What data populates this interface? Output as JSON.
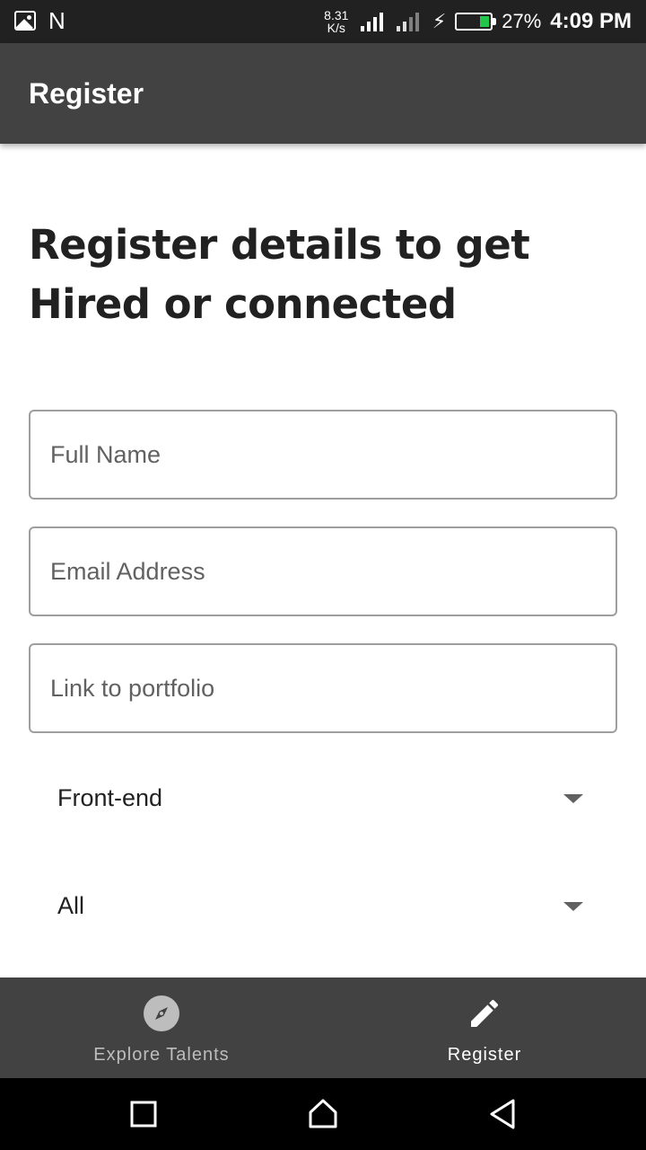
{
  "status_bar": {
    "notification_letter": "N",
    "speed_value": "8.31",
    "speed_unit": "K/s",
    "battery_percent": "27%",
    "time": "4:09 PM",
    "battery_color": "#22c64a",
    "icons": [
      "gallery-icon",
      "signal-icon",
      "charging-icon",
      "battery-icon"
    ]
  },
  "app_bar": {
    "title": "Register",
    "background": "#424242"
  },
  "main": {
    "headline_line1": "Register details to get",
    "headline_line2": "Hired or connected",
    "fields": {
      "full_name_placeholder": "Full Name",
      "email_placeholder": "Email Address",
      "portfolio_placeholder": "Link to portfolio"
    },
    "dropdowns": {
      "role_value": "Front-end",
      "filter_value": "All"
    }
  },
  "bottom_nav": {
    "items": [
      {
        "label": "Explore Talents",
        "icon": "compass-icon",
        "active": false
      },
      {
        "label": "Register",
        "icon": "pencil-icon",
        "active": true
      }
    ]
  },
  "system_nav": {
    "icons": [
      "recent-apps-icon",
      "home-icon",
      "back-icon"
    ]
  }
}
